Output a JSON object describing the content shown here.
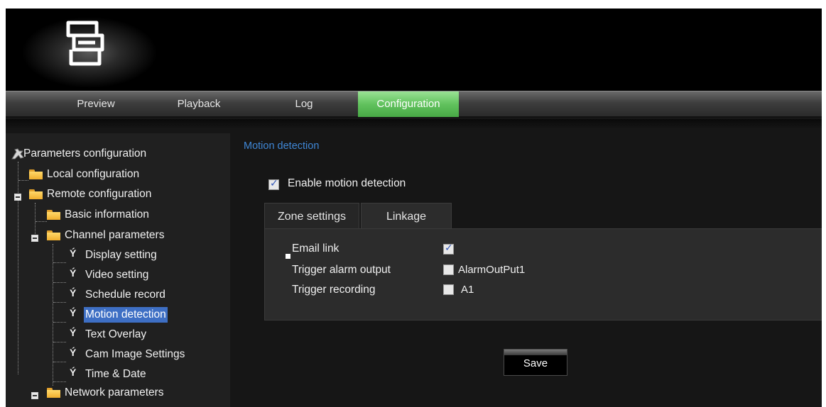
{
  "nav": {
    "tabs": [
      {
        "label": "Preview"
      },
      {
        "label": "Playback"
      },
      {
        "label": "Log"
      },
      {
        "label": "Configuration",
        "active": true
      }
    ]
  },
  "sidebar": {
    "root": "Parameters configuration",
    "items": [
      {
        "label": "Local configuration",
        "icon": "folder-icon"
      },
      {
        "label": "Remote configuration",
        "icon": "folder-icon"
      },
      {
        "label": "Basic information",
        "icon": "folder-icon"
      },
      {
        "label": "Channel parameters",
        "icon": "folder-icon"
      },
      {
        "label": "Display setting",
        "icon": "wrench-icon"
      },
      {
        "label": "Video setting",
        "icon": "wrench-icon"
      },
      {
        "label": "Schedule record",
        "icon": "wrench-icon"
      },
      {
        "label": "Motion detection",
        "icon": "wrench-icon",
        "selected": true
      },
      {
        "label": "Text Overlay",
        "icon": "wrench-icon"
      },
      {
        "label": "Cam Image Settings",
        "icon": "wrench-icon"
      },
      {
        "label": "Time & Date",
        "icon": "wrench-icon"
      },
      {
        "label": "Network parameters",
        "icon": "folder-icon"
      }
    ]
  },
  "main": {
    "title": "Motion detection",
    "enable_label": "Enable motion detection",
    "enable_checked": true,
    "tabs": [
      {
        "label": "Zone settings"
      },
      {
        "label": "Linkage",
        "active": true
      }
    ],
    "linkage": {
      "rows": [
        {
          "label": "Email link",
          "checked": true,
          "option": ""
        },
        {
          "label": "Trigger alarm output",
          "checked": false,
          "option": "AlarmOutPut1"
        },
        {
          "label": "Trigger recording",
          "checked": false,
          "option": "A1"
        }
      ]
    },
    "save_label": "Save"
  },
  "colors": {
    "accent_tab": "#5fc25a",
    "title_blue": "#3f87d6",
    "selection_blue": "#3e6fc4"
  }
}
